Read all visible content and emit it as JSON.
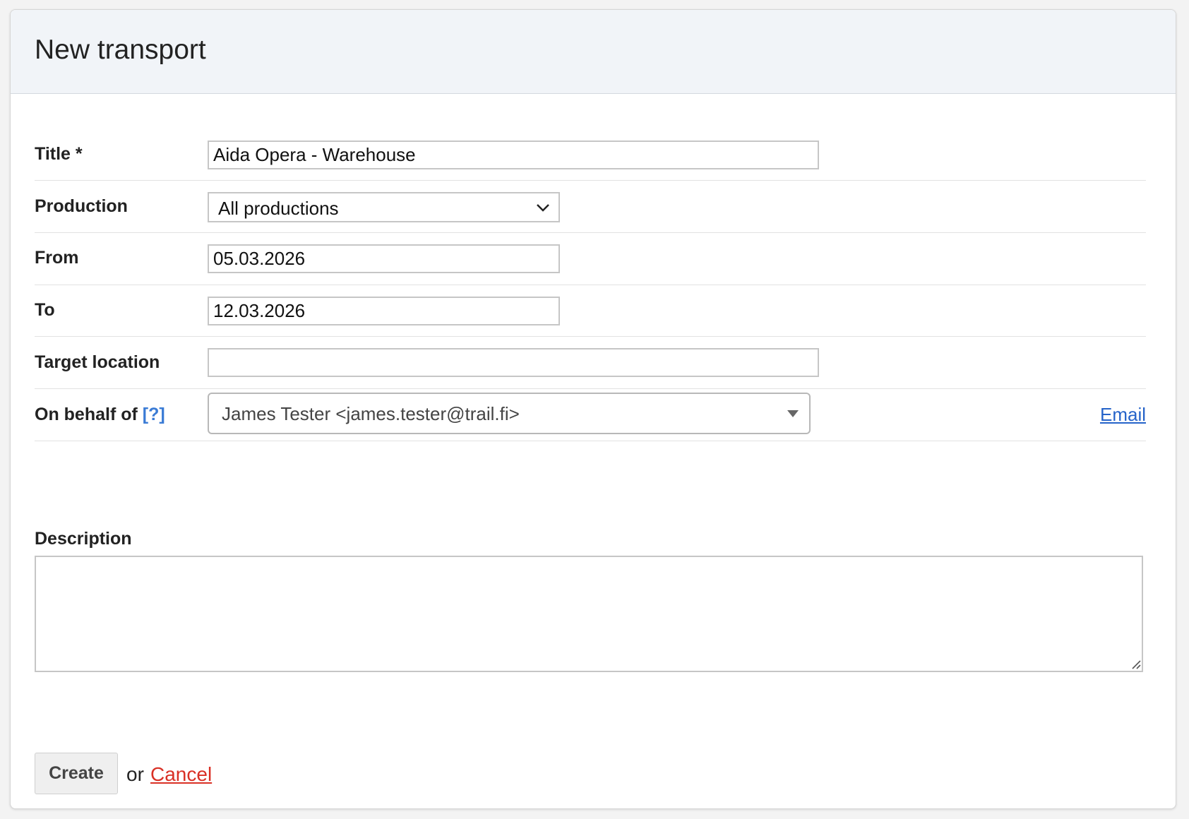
{
  "page": {
    "title": "New transport"
  },
  "form": {
    "title": {
      "label": "Title *",
      "value": "Aida Opera - Warehouse"
    },
    "production": {
      "label": "Production",
      "selected": "All productions"
    },
    "from": {
      "label": "From",
      "value": "05.03.2026"
    },
    "to": {
      "label": "To",
      "value": "12.03.2026"
    },
    "target_location": {
      "label": "Target location",
      "value": ""
    },
    "on_behalf_of": {
      "label": "On behalf of",
      "help": "[?]",
      "selected": "James Tester <james.tester@trail.fi>",
      "email_link": "Email"
    },
    "description": {
      "label": "Description",
      "value": ""
    }
  },
  "actions": {
    "create_label": "Create",
    "or_text": "or",
    "cancel_label": "Cancel"
  },
  "colors": {
    "header_bg": "#f1f4f8",
    "help_link": "#3a7bd5",
    "email_link": "#2563c9",
    "cancel_link": "#d93025"
  },
  "icons": {
    "production_select": "chevron-down-icon",
    "on_behalf_select": "caret-down-icon",
    "description_resize": "resize-grip-icon"
  }
}
